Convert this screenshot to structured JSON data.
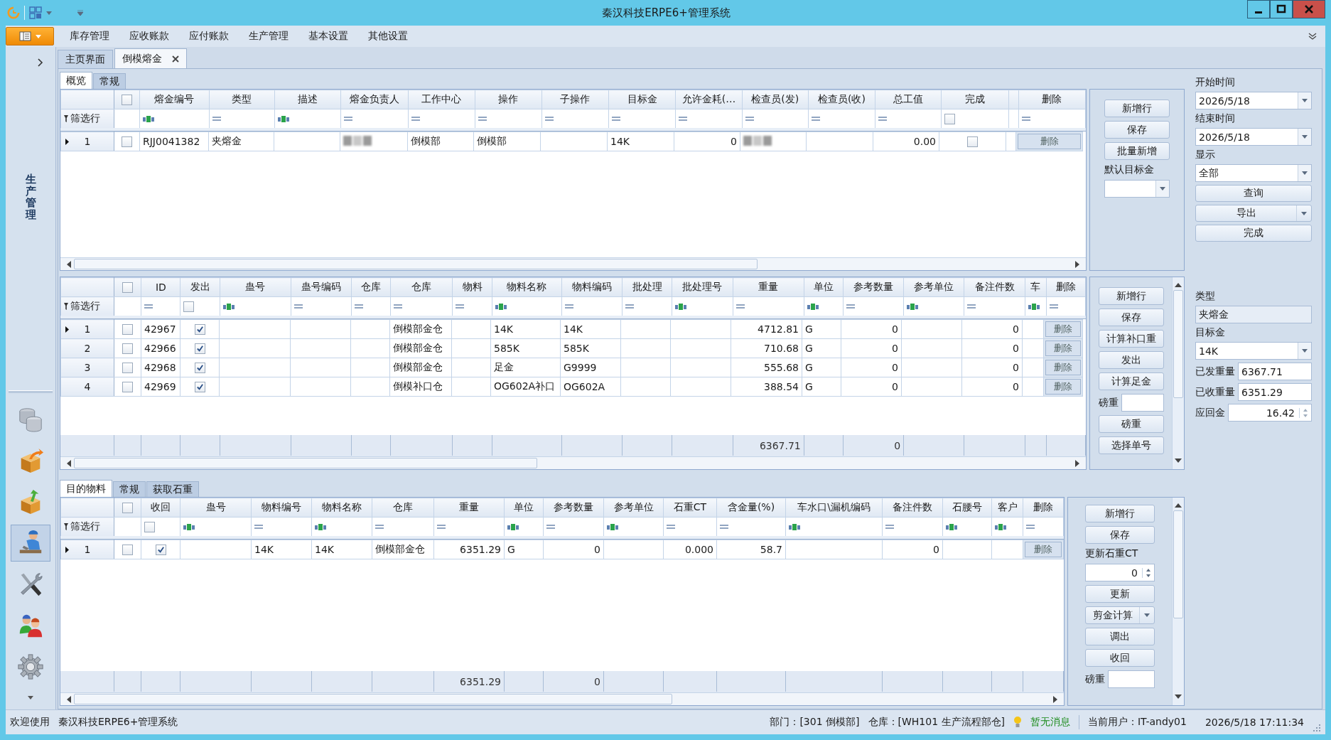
{
  "window": {
    "title": "秦汉科技ERPE6+管理系统"
  },
  "menu": [
    "库存管理",
    "应收账款",
    "应付账款",
    "生产管理",
    "基本设置",
    "其他设置"
  ],
  "sidebar": {
    "title": "生产管理",
    "items": [
      {
        "kind": "database",
        "selected": false
      },
      {
        "kind": "box-out",
        "selected": false
      },
      {
        "kind": "box-in",
        "selected": false
      },
      {
        "kind": "worker",
        "selected": true
      },
      {
        "kind": "tools",
        "selected": false
      },
      {
        "kind": "users",
        "selected": false
      },
      {
        "kind": "gear",
        "selected": false
      }
    ]
  },
  "doc_tabs": [
    {
      "label": "主页界面",
      "selected": false,
      "closable": false
    },
    {
      "label": "倒模熔金",
      "selected": true,
      "closable": true
    }
  ],
  "sections": [
    {
      "tabs": [
        {
          "label": "概览",
          "selected": true
        },
        {
          "label": "常规",
          "selected": false
        }
      ],
      "grid": {
        "filter_label": "筛选行",
        "columns": [
          {
            "kind": "select",
            "checked": false
          },
          {
            "label": "熔金编号",
            "kind": "text",
            "filter": {
              "kind": "abc"
            }
          },
          {
            "label": "类型",
            "kind": "text",
            "filter": {
              "kind": "eq"
            }
          },
          {
            "label": "描述",
            "kind": "text",
            "filter": {
              "kind": "abc"
            }
          },
          {
            "label": "熔金负责人",
            "kind": "text",
            "filter": {
              "kind": "eq"
            }
          },
          {
            "label": "工作中心",
            "kind": "text",
            "filter": {
              "kind": "eq"
            }
          },
          {
            "label": "操作",
            "kind": "text",
            "filter": {
              "kind": "eq"
            }
          },
          {
            "label": "子操作",
            "kind": "text",
            "filter": {
              "kind": "eq"
            }
          },
          {
            "label": "目标金",
            "kind": "text",
            "filter": {
              "kind": "eq"
            }
          },
          {
            "label": "允许金耗(…",
            "kind": "number",
            "filter": {
              "kind": "eq"
            }
          },
          {
            "label": "检查员(发)",
            "kind": "text",
            "filter": {
              "kind": "eq"
            }
          },
          {
            "label": "检查员(收)",
            "kind": "text",
            "filter": {
              "kind": "eq"
            }
          },
          {
            "label": "总工值",
            "kind": "number",
            "filter": {
              "kind": "eq"
            }
          },
          {
            "label": "完成",
            "kind": "check",
            "filter": {
              "kind": "check",
              "checked": false
            }
          },
          {
            "kind": "blank"
          },
          {
            "label": "删除",
            "kind": "delete",
            "filter": {
              "kind": "eq"
            }
          }
        ],
        "rows": [
          {
            "number": "1",
            "current": true,
            "cells": [
              {
                "checked": false
              },
              "RJJ0041382",
              "夹熔金",
              null,
              {
                "redacted": true
              },
              "倒模部",
              "倒模部",
              null,
              "14K",
              "0",
              {
                "redacted": true
              },
              null,
              "0.00",
              {
                "checked": false
              },
              null,
              "删除"
            ]
          }
        ]
      },
      "panel": [
        {
          "kind": "button",
          "label": "新增行"
        },
        {
          "kind": "button",
          "label": "保存"
        },
        {
          "kind": "button",
          "label": "批量新增"
        },
        {
          "kind": "label",
          "label": "默认目标金"
        },
        {
          "kind": "dropdown"
        }
      ]
    },
    {
      "grid": {
        "filter_label": "筛选行",
        "columns": [
          {
            "kind": "select",
            "checked": false
          },
          {
            "label": "ID",
            "kind": "text",
            "filter": {
              "kind": "eq"
            }
          },
          {
            "label": "发出",
            "kind": "check",
            "filter": {
              "kind": "check",
              "checked": false
            }
          },
          {
            "label": "蛊号",
            "kind": "text",
            "filter": {
              "kind": "abc"
            }
          },
          {
            "label": "蛊号编码",
            "kind": "text",
            "filter": {
              "kind": "eq"
            }
          },
          {
            "label": "仓库",
            "kind": "text",
            "filter": {
              "kind": "eq"
            }
          },
          {
            "label": "仓库",
            "kind": "text",
            "filter": {
              "kind": "eq"
            }
          },
          {
            "label": "物料",
            "kind": "text",
            "filter": {
              "kind": "eq"
            }
          },
          {
            "label": "物料名称",
            "kind": "text",
            "filter": {
              "kind": "abc"
            }
          },
          {
            "label": "物料编码",
            "kind": "text",
            "filter": {
              "kind": "eq"
            }
          },
          {
            "label": "批处理",
            "kind": "text",
            "filter": {
              "kind": "eq"
            }
          },
          {
            "label": "批处理号",
            "kind": "text",
            "filter": {
              "kind": "abc"
            }
          },
          {
            "label": "重量",
            "kind": "number",
            "filter": {
              "kind": "eq"
            },
            "total": "6367.71"
          },
          {
            "label": "单位",
            "kind": "text",
            "filter": {
              "kind": "abc"
            }
          },
          {
            "label": "参考数量",
            "kind": "number",
            "filter": {
              "kind": "eq"
            },
            "total": "0"
          },
          {
            "label": "参考单位",
            "kind": "text",
            "filter": {
              "kind": "abc"
            }
          },
          {
            "label": "备注件数",
            "kind": "number",
            "filter": {
              "kind": "eq"
            }
          },
          {
            "label": "车",
            "kind": "text",
            "filter": {
              "kind": "abc"
            }
          },
          {
            "label": "删除",
            "kind": "delete",
            "filter": {
              "kind": "eq"
            }
          }
        ],
        "rows": [
          {
            "number": "1",
            "current": true,
            "cells": [
              {
                "checked": false
              },
              "42967",
              {
                "checked": true
              },
              null,
              null,
              null,
              "倒模部金仓",
              null,
              "14K",
              "14K",
              null,
              null,
              "4712.81",
              "G",
              "0",
              null,
              "0",
              null,
              "删除"
            ]
          },
          {
            "number": "2",
            "current": false,
            "cells": [
              {
                "checked": false
              },
              "42966",
              {
                "checked": true
              },
              null,
              null,
              null,
              "倒模部金仓",
              null,
              "585K",
              "585K",
              null,
              null,
              "710.68",
              "G",
              "0",
              null,
              "0",
              null,
              "删除"
            ]
          },
          {
            "number": "3",
            "current": false,
            "cells": [
              {
                "checked": false
              },
              "42968",
              {
                "checked": true
              },
              null,
              null,
              null,
              "倒模部金仓",
              null,
              "足金",
              "G9999",
              null,
              null,
              "555.68",
              "G",
              "0",
              null,
              "0",
              null,
              "删除"
            ]
          },
          {
            "number": "4",
            "current": false,
            "cells": [
              {
                "checked": false
              },
              "42969",
              {
                "checked": true
              },
              null,
              null,
              null,
              "倒模补口仓",
              null,
              "OG602A补口",
              "OG602A",
              null,
              null,
              "388.54",
              "G",
              "0",
              null,
              "0",
              null,
              "删除"
            ]
          }
        ]
      },
      "panel": [
        {
          "kind": "button",
          "label": "新增行"
        },
        {
          "kind": "button",
          "label": "保存"
        },
        {
          "kind": "button",
          "label": "计算补口重"
        },
        {
          "kind": "button",
          "label": "发出"
        },
        {
          "kind": "button",
          "label": "计算足金"
        },
        {
          "kind": "labeled-field",
          "label": "磅重"
        },
        {
          "kind": "button",
          "label": "磅重"
        },
        {
          "kind": "button",
          "label": "选择单号"
        }
      ]
    },
    {
      "tabs": [
        {
          "label": "目的物料",
          "selected": true
        },
        {
          "label": "常规",
          "selected": false
        },
        {
          "label": "获取石重",
          "selected": false
        }
      ],
      "grid": {
        "filter_label": "筛选行",
        "columns": [
          {
            "kind": "select",
            "checked": false
          },
          {
            "label": "收回",
            "kind": "check",
            "filter": {
              "kind": "check",
              "checked": false
            }
          },
          {
            "label": "蛊号",
            "kind": "text",
            "filter": {
              "kind": "abc"
            }
          },
          {
            "label": "物料编号",
            "kind": "text",
            "filter": {
              "kind": "eq"
            }
          },
          {
            "label": "物料名称",
            "kind": "text",
            "filter": {
              "kind": "abc"
            }
          },
          {
            "label": "仓库",
            "kind": "text",
            "filter": {
              "kind": "eq"
            }
          },
          {
            "label": "重量",
            "kind": "number",
            "filter": {
              "kind": "eq"
            },
            "total": "6351.29"
          },
          {
            "label": "单位",
            "kind": "text",
            "filter": {
              "kind": "abc"
            }
          },
          {
            "label": "参考数量",
            "kind": "number",
            "filter": {
              "kind": "eq"
            },
            "total": "0"
          },
          {
            "label": "参考单位",
            "kind": "text",
            "filter": {
              "kind": "abc"
            }
          },
          {
            "label": "石重CT",
            "kind": "number",
            "filter": {
              "kind": "eq"
            }
          },
          {
            "label": "含金量(%)",
            "kind": "number",
            "filter": {
              "kind": "eq"
            }
          },
          {
            "label": "车水口\\漏机编码",
            "kind": "text",
            "filter": {
              "kind": "abc"
            }
          },
          {
            "label": "备注件数",
            "kind": "number",
            "filter": {
              "kind": "eq"
            }
          },
          {
            "label": "石腰号",
            "kind": "text",
            "filter": {
              "kind": "abc"
            }
          },
          {
            "label": "客户",
            "kind": "text",
            "filter": {
              "kind": "abc"
            }
          },
          {
            "label": "删除",
            "kind": "delete",
            "filter": {
              "kind": "eq"
            }
          }
        ],
        "rows": [
          {
            "number": "1",
            "current": true,
            "cells": [
              {
                "checked": false
              },
              {
                "checked": true
              },
              null,
              "14K",
              "14K",
              "倒模部金仓",
              "6351.29",
              "G",
              "0",
              null,
              "0.000",
              "58.7",
              null,
              "0",
              null,
              null,
              "删除"
            ]
          }
        ]
      },
      "panel": [
        {
          "kind": "button",
          "label": "新增行"
        },
        {
          "kind": "button",
          "label": "保存"
        },
        {
          "kind": "label",
          "label": "更新石重CT"
        },
        {
          "kind": "spin",
          "value": "0"
        },
        {
          "kind": "button",
          "label": "更新"
        },
        {
          "kind": "split-button",
          "label": "剪金计算"
        },
        {
          "kind": "button",
          "label": "调出"
        },
        {
          "kind": "button",
          "label": "收回"
        },
        {
          "kind": "labeled-field",
          "label": "磅重"
        }
      ]
    }
  ],
  "form": [
    {
      "kind": "label",
      "label": "开始时间"
    },
    {
      "kind": "dropdown",
      "value": "2026/5/18"
    },
    {
      "kind": "label",
      "label": "结束时间"
    },
    {
      "kind": "dropdown",
      "value": "2026/5/18"
    },
    {
      "kind": "label",
      "label": "显示"
    },
    {
      "kind": "dropdown",
      "value": "全部"
    },
    {
      "kind": "button",
      "label": "查询"
    },
    {
      "kind": "split-button",
      "label": "导出"
    },
    {
      "kind": "button",
      "label": "完成"
    },
    {
      "kind": "gap"
    },
    {
      "kind": "label",
      "label": "类型"
    },
    {
      "kind": "field",
      "value": "夹熔金"
    },
    {
      "kind": "label",
      "label": "目标金"
    },
    {
      "kind": "dropdown",
      "value": "14K"
    },
    {
      "kind": "labeled-field",
      "label": "已发重量",
      "value": "6367.71"
    },
    {
      "kind": "labeled-field",
      "label": "已收重量",
      "value": "6351.29"
    },
    {
      "kind": "labeled-spin",
      "label": "应回金",
      "value": "16.42"
    }
  ],
  "status_bar": {
    "welcome": "欢迎使用",
    "app": "秦汉科技ERPE6+管理系统",
    "department": "部门：[301 倒模部]",
    "warehouse": "仓库：[WH101 生产流程部仓]",
    "message": "暂无消息",
    "user": "当前用户：IT-andy01",
    "time": "2026/5/18 17:11:34"
  }
}
